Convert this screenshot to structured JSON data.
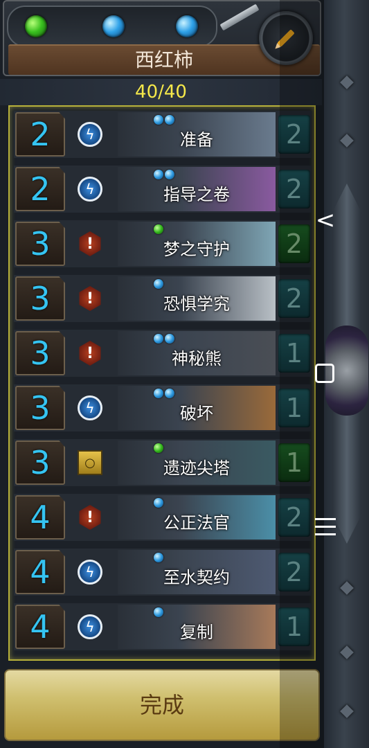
{
  "header": {
    "gems": [
      "green",
      "blue",
      "blue"
    ],
    "deck_name": "西红柿",
    "edit_icon": "pencil-icon"
  },
  "deck_count": "40/40",
  "cards": [
    {
      "cost": "2",
      "type": "spell",
      "gems": [
        "blue",
        "blue"
      ],
      "name": "准备",
      "qty": "2",
      "qty_color": "teal",
      "art": "#6a7b8e"
    },
    {
      "cost": "2",
      "type": "spell",
      "gems": [
        "blue",
        "blue"
      ],
      "name": "指导之卷",
      "qty": "2",
      "qty_color": "teal",
      "art": "#8a5aa0"
    },
    {
      "cost": "3",
      "type": "unit",
      "gems": [
        "green"
      ],
      "name": "梦之守护",
      "qty": "2",
      "qty_color": "green",
      "art": "#7fa6b5"
    },
    {
      "cost": "3",
      "type": "unit",
      "gems": [
        "blue"
      ],
      "name": "恐惧学究",
      "qty": "2",
      "qty_color": "teal",
      "art": "#b9c0c6"
    },
    {
      "cost": "3",
      "type": "unit",
      "gems": [
        "blue",
        "blue"
      ],
      "name": "神秘熊",
      "qty": "1",
      "qty_color": "teal",
      "art": "#4a4e55"
    },
    {
      "cost": "3",
      "type": "spell",
      "gems": [
        "blue",
        "blue"
      ],
      "name": "破坏",
      "qty": "1",
      "qty_color": "teal",
      "art": "#9a6a3a"
    },
    {
      "cost": "3",
      "type": "structure",
      "gems": [
        "green"
      ],
      "name": "遗迹尖塔",
      "qty": "1",
      "qty_color": "green",
      "art": "#3a5a62"
    },
    {
      "cost": "4",
      "type": "unit",
      "gems": [
        "blue"
      ],
      "name": "公正法官",
      "qty": "2",
      "qty_color": "teal",
      "art": "#4b8fa8"
    },
    {
      "cost": "4",
      "type": "spell",
      "gems": [
        "blue"
      ],
      "name": "至水契约",
      "qty": "2",
      "qty_color": "teal",
      "art": "#4e5a72"
    },
    {
      "cost": "4",
      "type": "spell",
      "gems": [
        "blue"
      ],
      "name": "复制",
      "qty": "1",
      "qty_color": "teal",
      "art": "#a87a5a"
    }
  ],
  "done_label": "完成",
  "nav": {
    "back": "<"
  }
}
